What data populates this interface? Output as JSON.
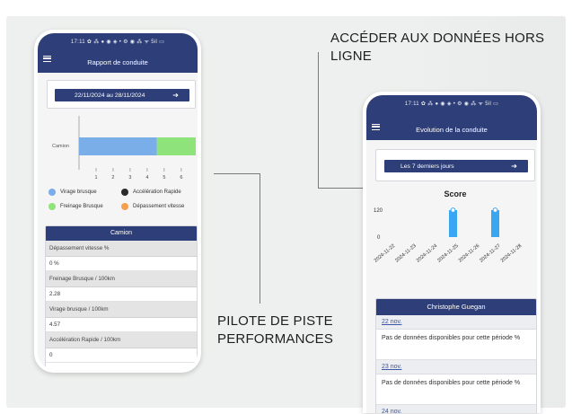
{
  "captions": {
    "offline": "ACCÉDER AUX DONNÉES HORS LIGNE",
    "performance": "PILOTE DE PISTE PERFORMANCES"
  },
  "phone1": {
    "status_bar": "17:11  ✿ ⁂ ● ◉ ◈ •     ⚙ ◉ ⁂ ᯤ 5il ▭",
    "title": "Rapport de conduite",
    "date_range": "22/11/2024 au 28/11/2024",
    "range_arrow": "➔",
    "chart_data": {
      "type": "bar",
      "orientation": "horizontal",
      "stacked": true,
      "categories": [
        "Camion"
      ],
      "series": [
        {
          "name": "Virage brusque",
          "values": [
            4.57
          ],
          "color": "#7aaee8"
        },
        {
          "name": "Freinage Brusque",
          "values": [
            2.28
          ],
          "color": "#8fe37b"
        },
        {
          "name": "Accélération Rapide",
          "values": [
            0
          ],
          "color": "#2b2b2b"
        },
        {
          "name": "Dépassement vitesse",
          "values": [
            0
          ],
          "color": "#f5a050"
        }
      ],
      "xticks": [
        "1",
        "2",
        "3",
        "4",
        "5",
        "6"
      ],
      "xlim": [
        0,
        6.85
      ],
      "legend_position": "bottom"
    },
    "table": {
      "title": "Camion",
      "rows": [
        {
          "label": "Dépassement vitesse %",
          "value": "0 %"
        },
        {
          "label": "Freinage Brusque / 100km",
          "value": "2.28"
        },
        {
          "label": "Virage brusque / 100km",
          "value": "4.57"
        },
        {
          "label": "Accélération Rapide / 100km",
          "value": "0"
        }
      ]
    }
  },
  "phone2": {
    "status_bar": "17:11  ✿ ⁂ ● ◉ ◈ •     ⚙ ◉ ⁂ ᯤ 5il ▭",
    "title": "Evolution de la conduite",
    "range_label": "Les 7 derniers jours",
    "range_arrow": "➔",
    "chart_data": {
      "type": "bar",
      "title": "Score",
      "categories": [
        "2024-11-22",
        "2024-11-23",
        "2024-11-24",
        "2024-11-25",
        "2024-11-26",
        "2024-11-27",
        "2024-11-28"
      ],
      "values": [
        0,
        0,
        0,
        120,
        0,
        120,
        0
      ],
      "yticks": [
        "120",
        "0"
      ],
      "ylim": [
        0,
        120
      ],
      "color": "#38a6f0",
      "grid": false
    },
    "table": {
      "title": "Christophe Guegan",
      "entries": [
        {
          "date": "22 nov.",
          "message": "Pas de données disponibles pour cette période %"
        },
        {
          "date": "23 nov.",
          "message": "Pas de données disponibles pour cette période %"
        },
        {
          "date": "24 nov.",
          "message": ""
        }
      ]
    }
  }
}
